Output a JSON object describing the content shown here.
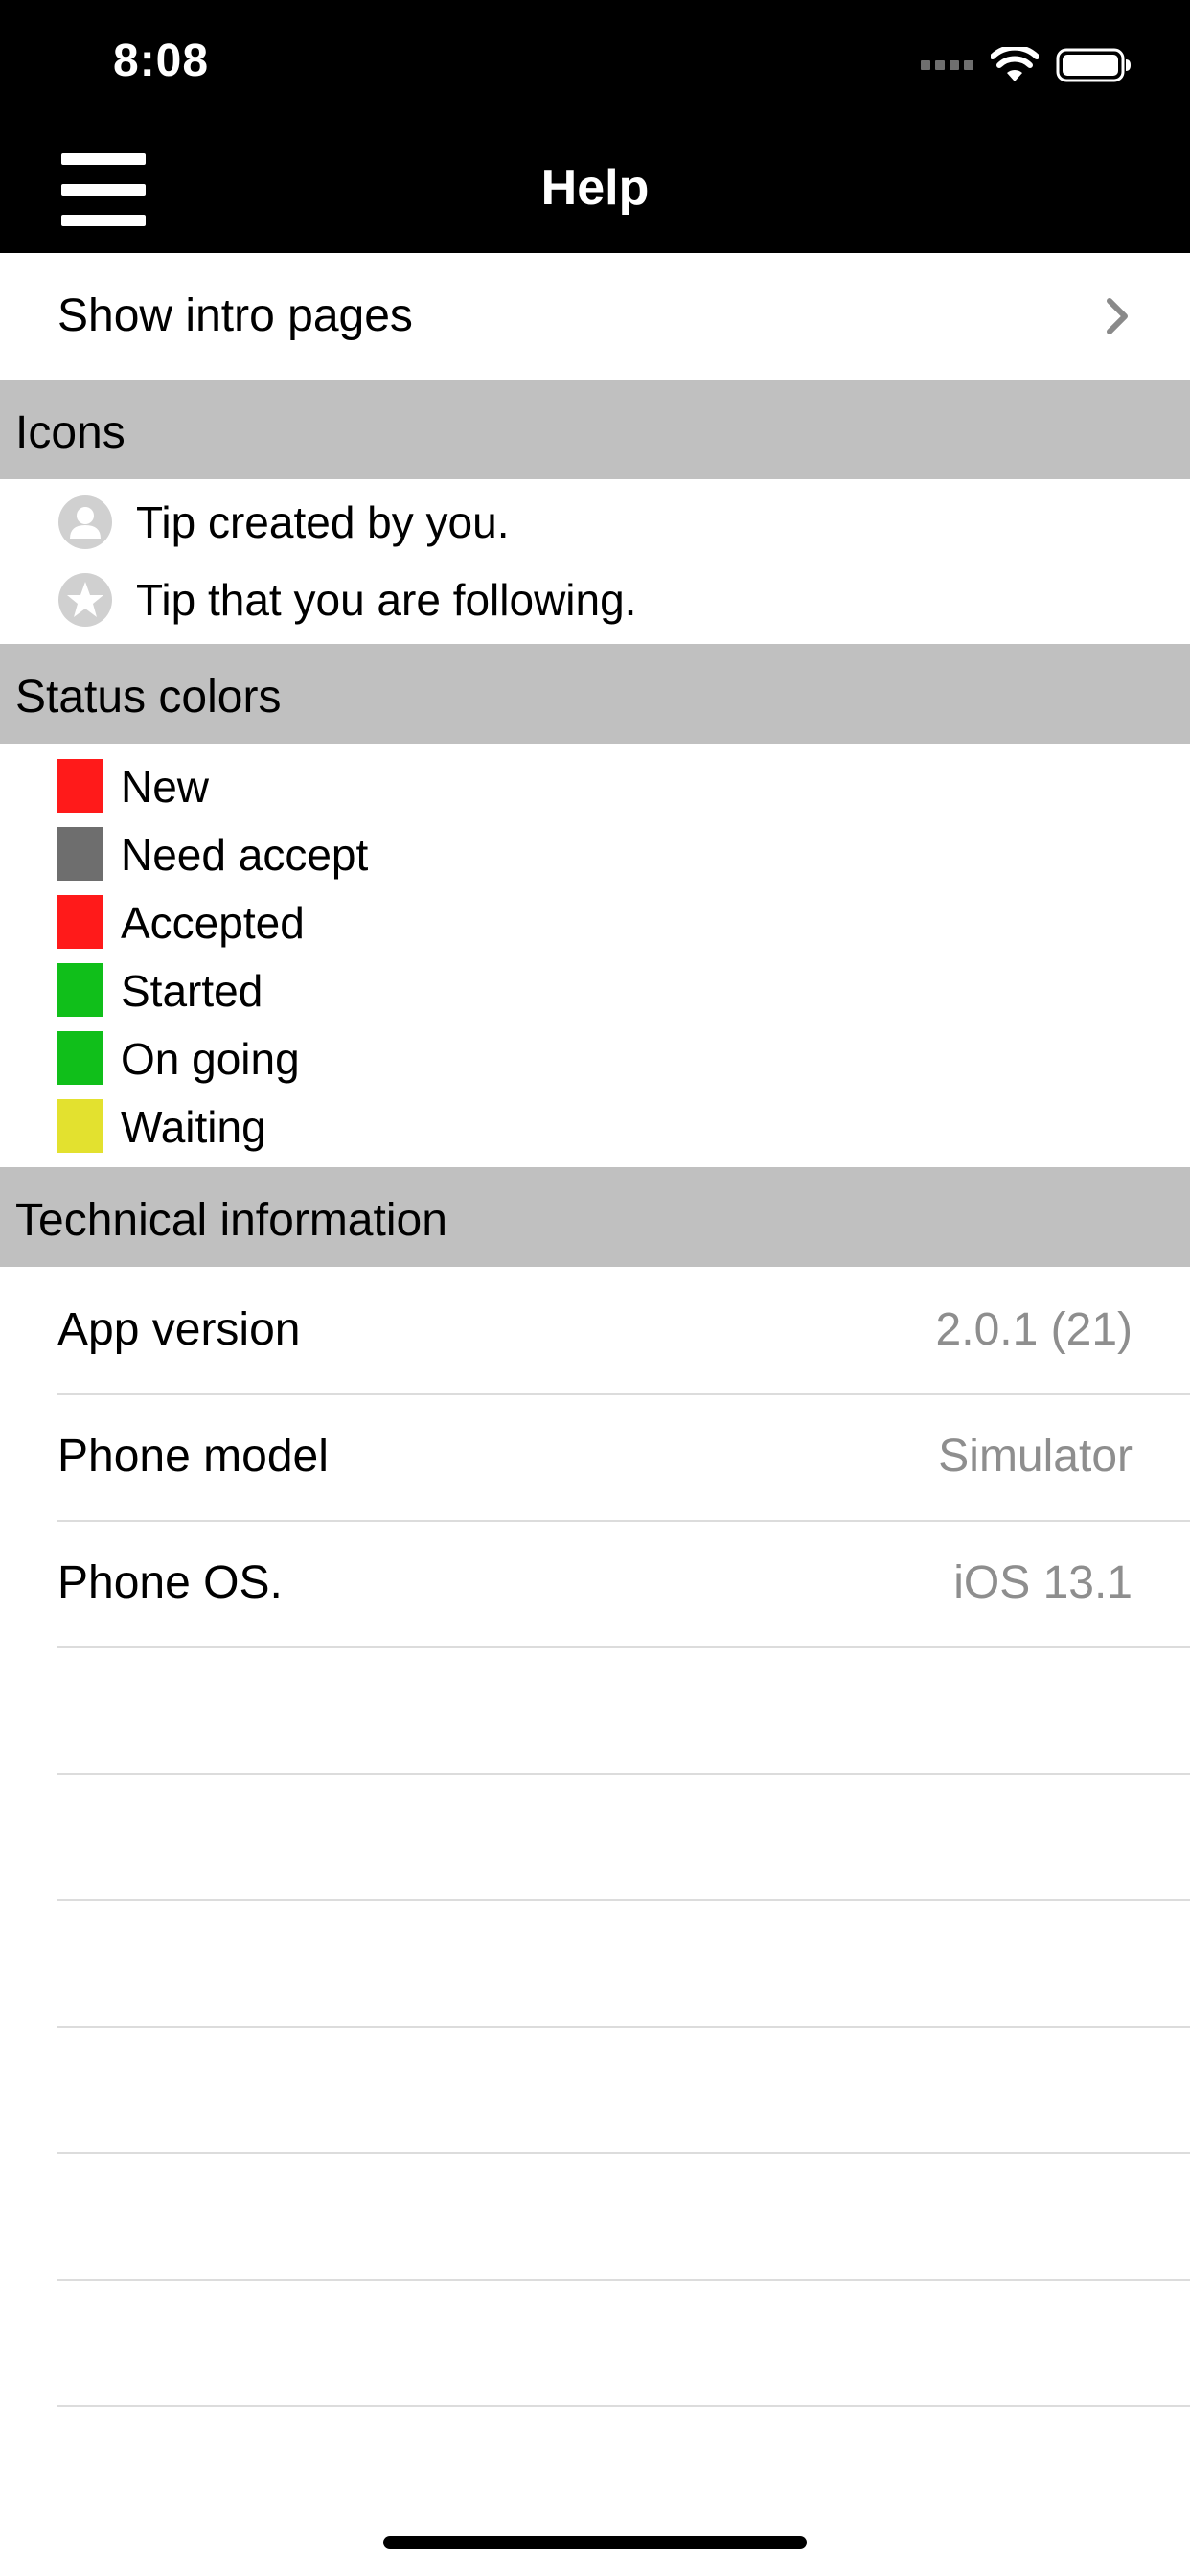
{
  "status_bar": {
    "time": "8:08"
  },
  "nav": {
    "title": "Help"
  },
  "intro": {
    "label": "Show intro pages"
  },
  "icons_section": {
    "title": "Icons",
    "items": [
      {
        "icon": "person-icon",
        "text": "Tip created by you."
      },
      {
        "icon": "star-icon",
        "text": "Tip that you are following."
      }
    ]
  },
  "status_section": {
    "title": "Status colors",
    "items": [
      {
        "label": "New",
        "color": "#ff1a1a"
      },
      {
        "label": "Need accept",
        "color": "#6e6e6e"
      },
      {
        "label": "Accepted",
        "color": "#ff1a1a"
      },
      {
        "label": "Started",
        "color": "#10bf1a"
      },
      {
        "label": "On going",
        "color": "#10bf1a"
      },
      {
        "label": "Waiting",
        "color": "#e3e12f"
      }
    ]
  },
  "tech_section": {
    "title": "Technical information",
    "rows": [
      {
        "key": "App version",
        "value": "2.0.1 (21)"
      },
      {
        "key": "Phone model",
        "value": "Simulator"
      },
      {
        "key": "Phone OS.",
        "value": "iOS 13.1"
      }
    ]
  }
}
